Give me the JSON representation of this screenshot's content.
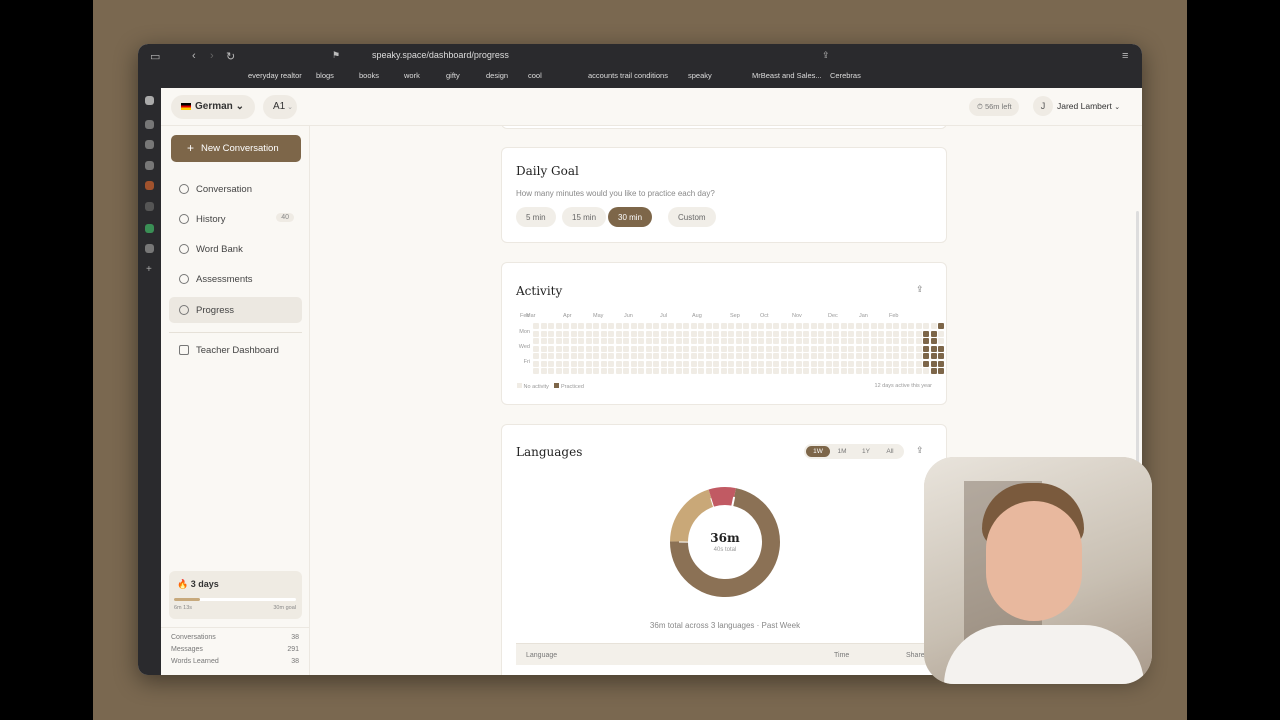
{
  "browser": {
    "url": "speaky.space/dashboard/progress",
    "bookmarks": [
      "everyday realtor",
      "blogs",
      "books",
      "work",
      "gifty",
      "design",
      "cool",
      "accounts",
      "trail conditions",
      "speaky",
      "MrBeast and Sales...",
      "Cerebras"
    ]
  },
  "topbar": {
    "language": "German",
    "level": "A1",
    "time_left": "56m left",
    "user_initial": "J",
    "user_name": "Jared Lambert"
  },
  "sidebar": {
    "new_conversation": "New Conversation",
    "items": [
      {
        "label": "Conversation",
        "badge": ""
      },
      {
        "label": "History",
        "badge": "40"
      },
      {
        "label": "Word Bank",
        "badge": ""
      },
      {
        "label": "Assessments",
        "badge": ""
      },
      {
        "label": "Progress",
        "badge": ""
      }
    ],
    "teacher": "Teacher Dashboard",
    "streak": {
      "label": "3 days",
      "progress_left": "6m 13s",
      "progress_right": "30m goal",
      "progress": 0.21
    },
    "stats": [
      {
        "label": "Conversations",
        "value": "38"
      },
      {
        "label": "Messages",
        "value": "291"
      },
      {
        "label": "Words Learned",
        "value": "38"
      }
    ]
  },
  "daily_goal": {
    "title": "Daily Goal",
    "question": "How many minutes would you like to practice each day?",
    "options": [
      "5 min",
      "15 min",
      "30 min",
      "Custom"
    ],
    "selected": "30 min"
  },
  "activity": {
    "title": "Activity",
    "months": [
      "Feb",
      "Mar",
      "Apr",
      "May",
      "Jun",
      "Jul",
      "Aug",
      "Sep",
      "Oct",
      "Nov",
      "Dec",
      "Jan",
      "Feb"
    ],
    "days": [
      "Mon",
      "Wed",
      "Fri"
    ],
    "legend_none": "No activity",
    "legend_practiced": "Practiced",
    "summary": "12 days active this year"
  },
  "languages": {
    "title": "Languages",
    "ranges": [
      "1W",
      "1M",
      "1Y",
      "All"
    ],
    "selected_range": "1W",
    "center_value": "36m",
    "center_sub": "40s total",
    "caption": "36m total across 3 languages · Past Week",
    "table_headers": [
      "Language",
      "Time",
      "Share"
    ],
    "donut": [
      {
        "share": 0.72,
        "color": "#8b7155"
      },
      {
        "share": 0.2,
        "color": "#c9a878"
      },
      {
        "share": 0.08,
        "color": "#c15a63"
      }
    ]
  }
}
